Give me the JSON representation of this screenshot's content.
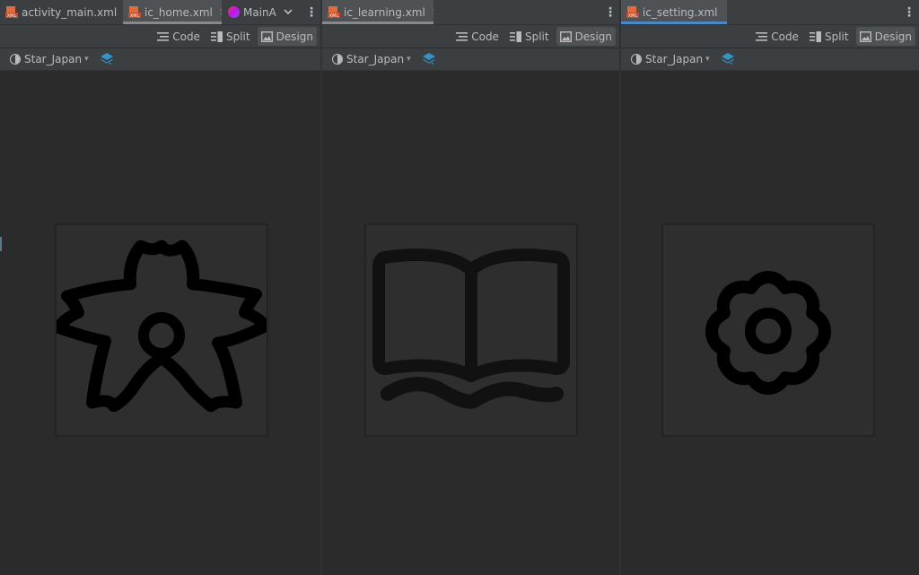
{
  "panes": [
    {
      "tabs": [
        {
          "label": "activity_main.xml",
          "type": "xml"
        },
        {
          "label": "ic_home.xml",
          "type": "xml"
        },
        {
          "label": "MainA",
          "type": "kotlin"
        }
      ],
      "view_modes": [
        "Code",
        "Split",
        "Design"
      ],
      "selected_view": "Design",
      "theme": "Star_Japan",
      "preview_icon": "sakura-flower-icon"
    },
    {
      "tabs": [
        {
          "label": "ic_learning.xml",
          "type": "xml"
        }
      ],
      "view_modes": [
        "Code",
        "Split",
        "Design"
      ],
      "selected_view": "Design",
      "theme": "Star_Japan",
      "preview_icon": "open-book-icon"
    },
    {
      "tabs": [
        {
          "label": "ic_setting.xml",
          "type": "xml"
        }
      ],
      "view_modes": [
        "Code",
        "Split",
        "Design"
      ],
      "selected_view": "Design",
      "theme": "Star_Japan",
      "preview_icon": "gear-icon"
    }
  ],
  "colors": {
    "background": "#2b2b2b",
    "toolbar": "#3c3f41",
    "xml_file_icon": "#e06c3c",
    "active_tab_underline": "#4a88c7",
    "layers_icon": "#3592c4",
    "preview_stroke": "#000000"
  }
}
